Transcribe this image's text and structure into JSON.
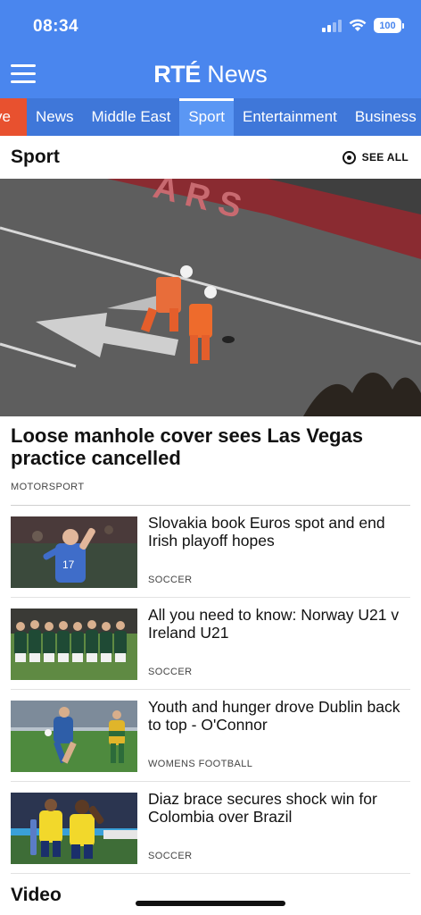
{
  "status_bar": {
    "time": "08:34",
    "battery": "100"
  },
  "header": {
    "logo_rte": "RTÉ",
    "logo_news": "News"
  },
  "tabs": [
    {
      "label": "ve"
    },
    {
      "label": "News"
    },
    {
      "label": "Middle East"
    },
    {
      "label": "Sport"
    },
    {
      "label": "Entertainment"
    },
    {
      "label": "Business"
    }
  ],
  "active_tab": "Sport",
  "section": {
    "title": "Sport",
    "see_all": "SEE ALL"
  },
  "hero": {
    "title": "Loose manhole cover sees Las Vegas practice cancelled",
    "category": "MOTORSPORT",
    "image": "two-marshals-on-race-track-photo"
  },
  "stories": [
    {
      "title": "Slovakia book Euros spot and end Irish playoff hopes",
      "category": "SOCCER",
      "image": "slovakia-player-celebrating-photo"
    },
    {
      "title": "All you need to know: Norway U21 v Ireland U21",
      "category": "SOCCER",
      "image": "ireland-u21-team-lineup-photo"
    },
    {
      "title": "Youth and hunger drove Dublin back to top - O'Connor",
      "category": "WOMENS FOOTBALL",
      "image": "womens-football-match-photo"
    },
    {
      "title": "Diaz brace secures shock win for Colombia over Brazil",
      "category": "SOCCER",
      "image": "colombia-players-celebrating-photo"
    }
  ],
  "next_section": {
    "title": "Video"
  },
  "colors": {
    "header_blue": "#4a86ee",
    "tab_blue": "#3f77d9",
    "active_tab": "#5b97f4",
    "live_red": "#e8512f"
  }
}
